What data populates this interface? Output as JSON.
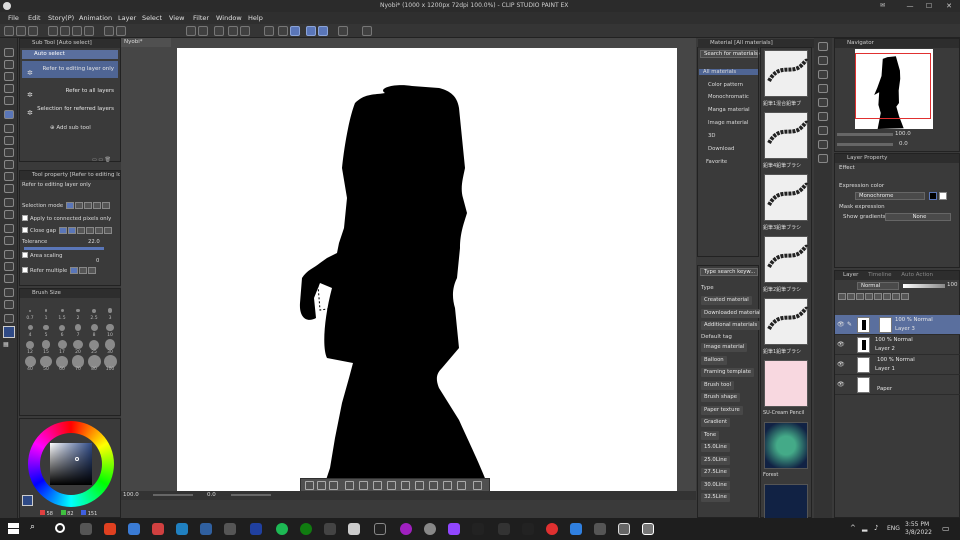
{
  "window": {
    "title": "Nyobi* (1000 x 1200px 72dpi 100.0%) - CLIP STUDIO PAINT EX",
    "minimize": "—",
    "maximize": "☐",
    "close": "✕"
  },
  "menu": [
    "File",
    "Edit",
    "Story(P)",
    "Animation",
    "Layer",
    "Select",
    "View",
    "Filter",
    "Window",
    "Help"
  ],
  "subtool": {
    "header": "Sub Tool [Auto select]",
    "tab": "Auto select",
    "items": [
      "Refer to editing layer only",
      "Refer to all layers",
      "Selection for referred layers"
    ],
    "add": "Add sub tool"
  },
  "tool_property": {
    "header": "Tool property [Refer to editing lo...",
    "name": "Refer to editing layer only",
    "selection_mode": "Selection mode",
    "apply_connected": "Apply to connected pixels only",
    "close_gap": "Close gap",
    "tolerance_label": "Tolerance",
    "tolerance_value": "22.0",
    "area_scaling": "Area scaling",
    "area_scaling_value": "0",
    "refer_multiple": "Refer multiple"
  },
  "brush_size": {
    "header": "Brush Size",
    "labels": [
      "0.7",
      "1",
      "1.5",
      "2",
      "2.5",
      "3",
      "4",
      "5",
      "6",
      "7",
      "8",
      "10",
      "12",
      "15",
      "17",
      "20",
      "25",
      "30",
      "40",
      "50",
      "60",
      "70",
      "80",
      "100"
    ]
  },
  "color": {
    "value_r": "58",
    "value_g": "82",
    "value_b": "151",
    "main": "#2f4a86",
    "sub": "#ffffff"
  },
  "canvas": {
    "tab": "Nyobi*",
    "zoom": "100.0",
    "angle": "0.0"
  },
  "materials": {
    "search_placeholder": "Search for materials on ...",
    "header": "Material [All materials]",
    "tree": [
      "All materials",
      "Color pattern",
      "Monochromatic",
      "Manga material",
      "Image material",
      "3D",
      "Download",
      "Favorite"
    ],
    "tag_search_placeholder": "Type search keyw...",
    "type_label": "Type",
    "types": [
      "Created material",
      "Downloaded material",
      "Additional materials"
    ],
    "default_tag_label": "Default tag",
    "tags": [
      "Image material",
      "Balloon",
      "Framing template",
      "Brush tool",
      "Brush shape",
      "Paper texture",
      "Gradient",
      "Tone",
      "15.0Line",
      "25.0Line",
      "27.5Line",
      "30.0Line",
      "32.5Line"
    ],
    "thumbs": [
      "鉛筆1混合鉛筆ブ",
      "鉛筆4鉛筆ブラシ",
      "鉛筆3鉛筆ブラシ",
      "鉛筆2鉛筆ブラシ",
      "鉛筆1鉛筆ブラシ",
      "SU-Cream Pencil",
      "Forest",
      ""
    ]
  },
  "navigator": {
    "header": "Navigator",
    "zoom": "100.0",
    "angle": "0.0"
  },
  "layer_property": {
    "header": "Layer Property",
    "effect": "Effect",
    "expression_color": "Expression color",
    "expression_value": "Monochrome",
    "mask_expression": "Mask expression",
    "show_gradients": "Show gradients",
    "show_gradients_value": "None"
  },
  "layers": {
    "tabs": [
      "Layer",
      "Timeline",
      "Auto Action"
    ],
    "blend": "Normal",
    "opacity": "100",
    "rows": [
      {
        "pct": "100 % Normal",
        "name": "Layer 3"
      },
      {
        "pct": "100 % Normal",
        "name": "Layer 2"
      },
      {
        "pct": "100 % Normal",
        "name": "Layer 1"
      },
      {
        "pct": "",
        "name": "Paper"
      }
    ]
  },
  "taskbar": {
    "lang": "ENG",
    "time": "3:55 PM",
    "date": "3/8/2022"
  },
  "accent": "#5a76b8"
}
